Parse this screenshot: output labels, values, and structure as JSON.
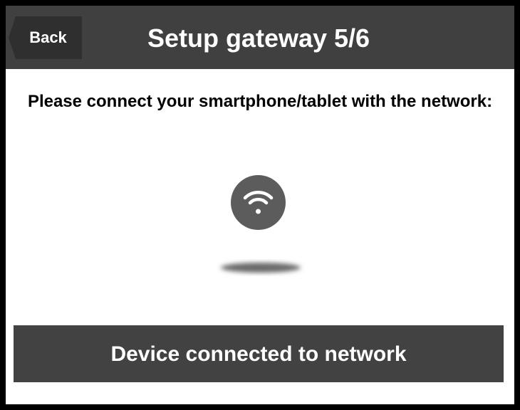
{
  "header": {
    "back_label": "Back",
    "title": "Setup gateway 5/6"
  },
  "main": {
    "instruction": "Please connect your smartphone/tablet with the network:",
    "wifi_icon": "wifi-icon",
    "network_name_redacted": true
  },
  "footer": {
    "confirm_label": "Device connected to network"
  },
  "colors": {
    "header_background": "#404040",
    "button_background": "#424242",
    "badge_background": "#5c5c5c",
    "page_background": "#ffffff",
    "frame_border": "#000000"
  }
}
